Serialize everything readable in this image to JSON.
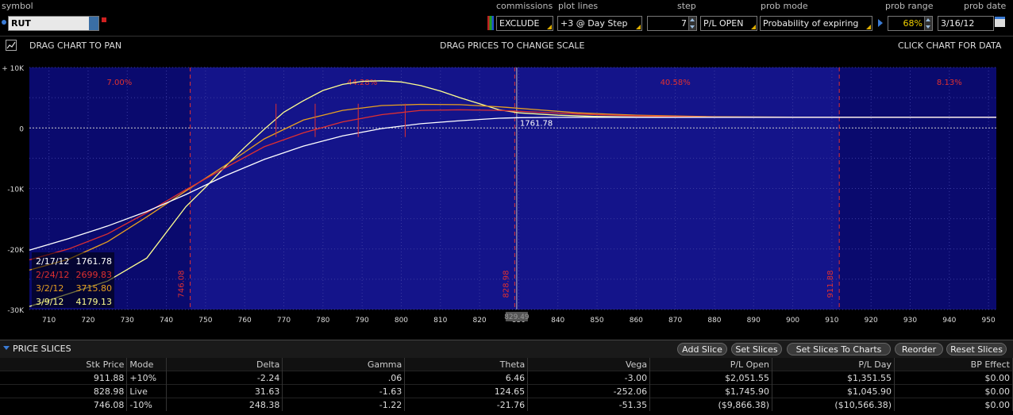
{
  "toolbar": {
    "symbol_label": "symbol",
    "symbol_value": "RUT",
    "commissions_label": "commissions",
    "commissions_value": "EXCLUDE",
    "plot_lines_label": "plot lines",
    "plot_lines_value": "+3 @ Day Step",
    "step_label": "step",
    "step_value": "7",
    "pl_mode_value": "P/L OPEN",
    "prob_mode_label": "prob mode",
    "prob_mode_value": "Probability of expiring",
    "prob_range_label": "prob range",
    "prob_range_value": "68%",
    "prob_date_label": "prob date",
    "prob_date_value": "3/16/12"
  },
  "chart_header": {
    "pan_hint": "DRAG CHART TO PAN",
    "scale_hint": "DRAG PRICES TO CHANGE SCALE",
    "data_hint": "CLICK CHART FOR DATA"
  },
  "chart_data": {
    "type": "line",
    "x_ticks": [
      "710",
      "720",
      "730",
      "740",
      "750",
      "760",
      "770",
      "780",
      "790",
      "800",
      "810",
      "820",
      "830",
      "840",
      "850",
      "860",
      "870",
      "880",
      "890",
      "900",
      "910",
      "920",
      "930",
      "940",
      "950"
    ],
    "y_ticks": [
      "+ 10K",
      "0",
      "-10K",
      "-20K",
      "-30K"
    ],
    "xlim": [
      705,
      952
    ],
    "ylim": [
      -30000,
      10000
    ],
    "price_lines": [
      {
        "price": 746.08,
        "label": "746.08",
        "color": "#e03030"
      },
      {
        "price": 828.98,
        "label": "828.98",
        "color": "#e03030"
      },
      {
        "price": 911.88,
        "label": "911.88",
        "color": "#e03030"
      }
    ],
    "prob_zones": [
      {
        "label": "7.00%",
        "x": 728
      },
      {
        "label": "44.28%",
        "x": 790
      },
      {
        "label": "40.58%",
        "x": 870
      },
      {
        "label": "8.13%",
        "x": 940
      }
    ],
    "current_price_label": "829.49",
    "current_value_label": "1761.78",
    "series": [
      {
        "name": "2/17/12",
        "value_label": "1761.78",
        "color": "#ffffff",
        "x": [
          705,
          715,
          725,
          735,
          745,
          755,
          765,
          775,
          785,
          795,
          805,
          815,
          825,
          830,
          840,
          850,
          860,
          870,
          880,
          900,
          952
        ],
        "y": [
          -20200,
          -18300,
          -16200,
          -13800,
          -11000,
          -7900,
          -5200,
          -3000,
          -1300,
          -100,
          700,
          1200,
          1600,
          1700,
          1750,
          1760,
          1760,
          1762,
          1762,
          1762,
          1762
        ]
      },
      {
        "name": "2/24/12",
        "value_label": "2699.83",
        "color": "#e03030",
        "x": [
          705,
          715,
          725,
          735,
          745,
          755,
          765,
          775,
          785,
          795,
          805,
          815,
          825,
          835,
          845,
          860,
          880,
          900,
          952
        ],
        "y": [
          -21800,
          -20000,
          -17500,
          -14000,
          -10200,
          -6600,
          -3100,
          -800,
          1000,
          2200,
          2900,
          3000,
          2900,
          2600,
          2300,
          2000,
          1800,
          1770,
          1762
        ]
      },
      {
        "name": "3/2/12",
        "value_label": "3715.80",
        "color": "#e8a020",
        "x": [
          705,
          715,
          725,
          735,
          745,
          755,
          765,
          775,
          785,
          795,
          805,
          815,
          825,
          835,
          845,
          860,
          880,
          900,
          952
        ],
        "y": [
          -23500,
          -21700,
          -18800,
          -14700,
          -10400,
          -6200,
          -1800,
          1300,
          2900,
          3700,
          3900,
          3850,
          3500,
          3000,
          2500,
          2100,
          1850,
          1780,
          1762
        ]
      },
      {
        "name": "3/9/12",
        "value_label": "4179.13",
        "color": "#ffff90",
        "x": [
          705,
          725,
          735,
          745,
          750,
          755,
          760,
          765,
          770,
          775,
          780,
          785,
          790,
          795,
          800,
          805,
          810,
          815,
          820,
          825,
          830,
          840,
          850,
          860,
          880,
          900,
          952
        ],
        "y": [
          -29500,
          -25300,
          -21500,
          -13000,
          -9800,
          -6400,
          -3200,
          -200,
          2600,
          4500,
          6200,
          7200,
          7700,
          7800,
          7600,
          7000,
          6100,
          5000,
          4000,
          3000,
          2500,
          2100,
          1900,
          1800,
          1770,
          1762,
          1762
        ]
      }
    ]
  },
  "price_slices": {
    "title": "PRICE SLICES",
    "buttons": [
      "Add Slice",
      "Set Slices",
      "Set Slices To Charts",
      "Reorder",
      "Reset Slices"
    ],
    "columns": [
      "Stk Price",
      "Mode",
      "Delta",
      "Gamma",
      "Theta",
      "Vega",
      "P/L Open",
      "P/L Day",
      "BP Effect"
    ],
    "rows": [
      [
        "911.88",
        "+10%",
        "-2.24",
        ".06",
        "6.46",
        "-3.00",
        "$2,051.55",
        "$1,351.55",
        "$0.00"
      ],
      [
        "828.98",
        "Live",
        "31.63",
        "-1.63",
        "124.65",
        "-252.06",
        "$1,745.90",
        "$1,045.90",
        "$0.00"
      ],
      [
        "746.08",
        "-10%",
        "248.38",
        "-1.22",
        "-21.76",
        "-51.35",
        "($9,866.38)",
        "($10,566.38)",
        "$0.00"
      ]
    ]
  }
}
